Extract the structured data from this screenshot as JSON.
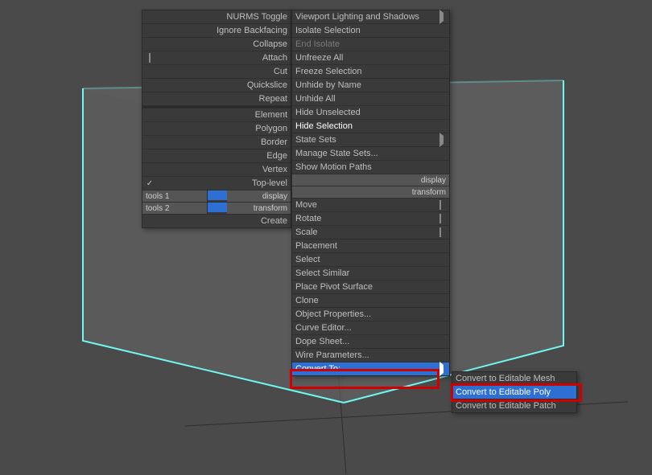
{
  "left_menu": {
    "items": [
      {
        "label": "NURMS Toggle"
      },
      {
        "label": "Ignore Backfacing"
      },
      {
        "label": "Collapse"
      },
      {
        "label": "Attach",
        "icon": "square"
      },
      {
        "label": "Cut"
      },
      {
        "label": "Quickslice"
      },
      {
        "label": "Repeat",
        "gap_after": true
      },
      {
        "label": "Element"
      },
      {
        "label": "Polygon"
      },
      {
        "label": "Border"
      },
      {
        "label": "Edge"
      },
      {
        "label": "Vertex"
      },
      {
        "label": "Top-level",
        "icon": "check"
      }
    ],
    "twin1_left": "tools 1",
    "twin1_right": "display",
    "twin2_left": "tools 2",
    "twin2_right": "transform",
    "footer": {
      "label": "Create"
    }
  },
  "right_menu": {
    "items": [
      {
        "label": "Viewport Lighting and Shadows",
        "submenu": true
      },
      {
        "label": "Isolate Selection"
      },
      {
        "label": "End Isolate",
        "disabled": true
      },
      {
        "label": "Unfreeze All"
      },
      {
        "label": "Freeze Selection"
      },
      {
        "label": "Unhide by Name"
      },
      {
        "label": "Unhide All"
      },
      {
        "label": "Hide Unselected"
      },
      {
        "label": "Hide Selection",
        "white": true
      },
      {
        "label": "State Sets",
        "submenu": true
      },
      {
        "label": "Manage State Sets..."
      },
      {
        "label": "Show Motion Paths"
      }
    ],
    "items2": [
      {
        "label": "Move",
        "icon": "square"
      },
      {
        "label": "Rotate",
        "icon": "square"
      },
      {
        "label": "Scale",
        "icon": "square"
      },
      {
        "label": "Placement"
      },
      {
        "label": "Select"
      },
      {
        "label": "Select Similar"
      },
      {
        "label": "Place Pivot Surface"
      },
      {
        "label": "Clone"
      },
      {
        "label": "Object Properties..."
      },
      {
        "label": "Curve Editor..."
      },
      {
        "label": "Dope Sheet..."
      },
      {
        "label": "Wire Parameters..."
      },
      {
        "label": "Convert To:",
        "submenu": true,
        "hovered": true
      }
    ]
  },
  "submenu": {
    "items": [
      {
        "label": "Convert to Editable Mesh"
      },
      {
        "label": "Convert to Editable Poly",
        "hovered": true
      },
      {
        "label": "Convert to Editable Patch"
      }
    ]
  }
}
